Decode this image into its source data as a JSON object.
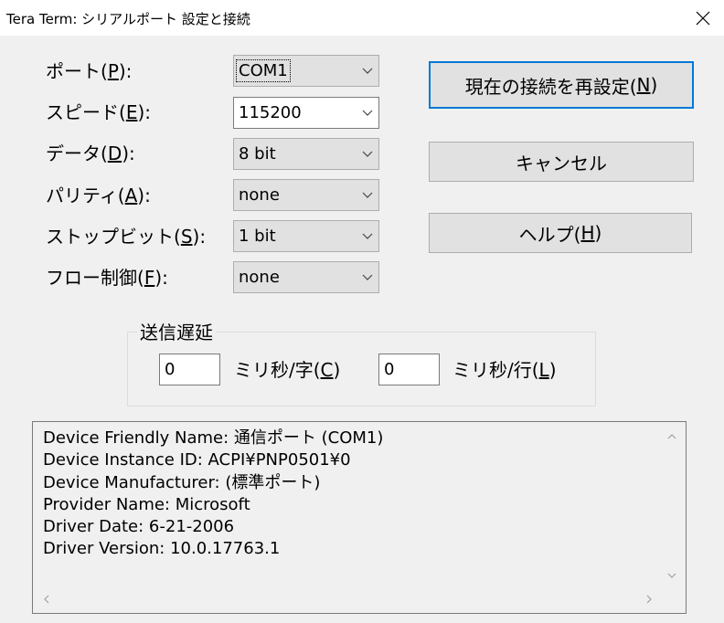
{
  "window": {
    "title": "Tera Term: シリアルポート 設定と接続",
    "close_glyph": "✕"
  },
  "form": {
    "fields": [
      {
        "label": "ポート(",
        "key": "P",
        "suffix": "):",
        "value": "COM1"
      },
      {
        "label": "スピード(",
        "key": "E",
        "suffix": "):",
        "value": "115200"
      },
      {
        "label": "データ(",
        "key": "D",
        "suffix": "):",
        "value": "8 bit"
      },
      {
        "label": "パリティ(",
        "key": "A",
        "suffix": "):",
        "value": "none"
      },
      {
        "label": "ストップビット(",
        "key": "S",
        "suffix": "):",
        "value": "1 bit"
      },
      {
        "label": "フロー制御(",
        "key": "F",
        "suffix": "):",
        "value": "none"
      }
    ]
  },
  "buttons": {
    "reconnect": {
      "label": "現在の接続を再設定(",
      "key": "N",
      "suffix": ")"
    },
    "cancel": {
      "label": "キャンセル"
    },
    "help": {
      "label": "ヘルプ(",
      "key": "H",
      "suffix": ")"
    }
  },
  "delay": {
    "title": "送信遅延",
    "char_value": "0",
    "char_label": "ミリ秒/字(",
    "char_key": "C",
    "char_suffix": ")",
    "line_value": "0",
    "line_label": "ミリ秒/行(",
    "line_key": "L",
    "line_suffix": ")"
  },
  "info": {
    "lines": [
      "Device Friendly Name: 通信ポート (COM1)",
      "Device Instance ID: ACPI¥PNP0501¥0",
      "Device Manufacturer: (標準ポート)",
      "Provider Name: Microsoft",
      "Driver Date: 6-21-2006",
      "Driver Version: 10.0.17763.1"
    ]
  },
  "icons": {
    "dropdown": "chevron-down-icon",
    "close": "close-icon",
    "scroll_up": "chevron-up-icon",
    "scroll_down": "chevron-down-icon",
    "scroll_left": "chevron-left-icon",
    "scroll_right": "chevron-right-icon"
  },
  "colors": {
    "accent": "#0078d7",
    "face": "#f0f0f0",
    "button": "#e1e1e1"
  }
}
